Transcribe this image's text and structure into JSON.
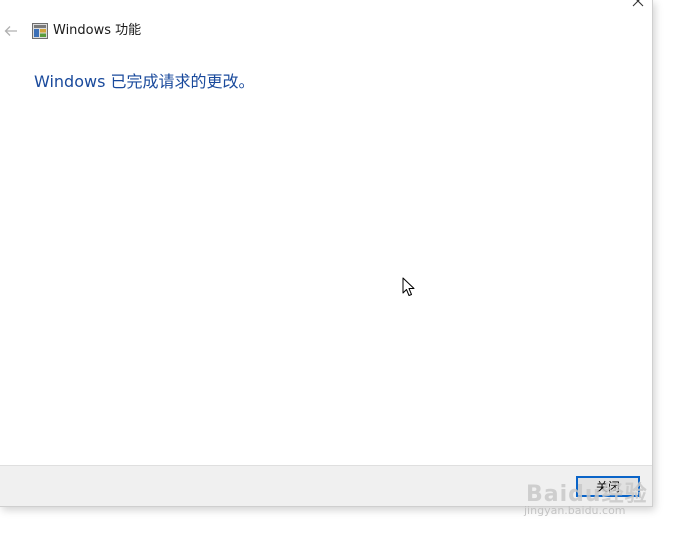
{
  "window": {
    "title": "Windows 功能",
    "heading": "Windows 已完成请求的更改。"
  },
  "footer": {
    "close_label": "关闭"
  },
  "watermark": {
    "brand": "Baidu经验",
    "url": "jingyan.baidu.com"
  },
  "icons": {
    "back": "back-arrow-icon",
    "app": "windows-features-icon",
    "close": "close-icon",
    "cursor": "mouse-pointer-icon"
  },
  "colors": {
    "heading": "#1a4a9c",
    "footer_bg": "#f0f0f0",
    "button_focus_border": "#0a64c8"
  }
}
